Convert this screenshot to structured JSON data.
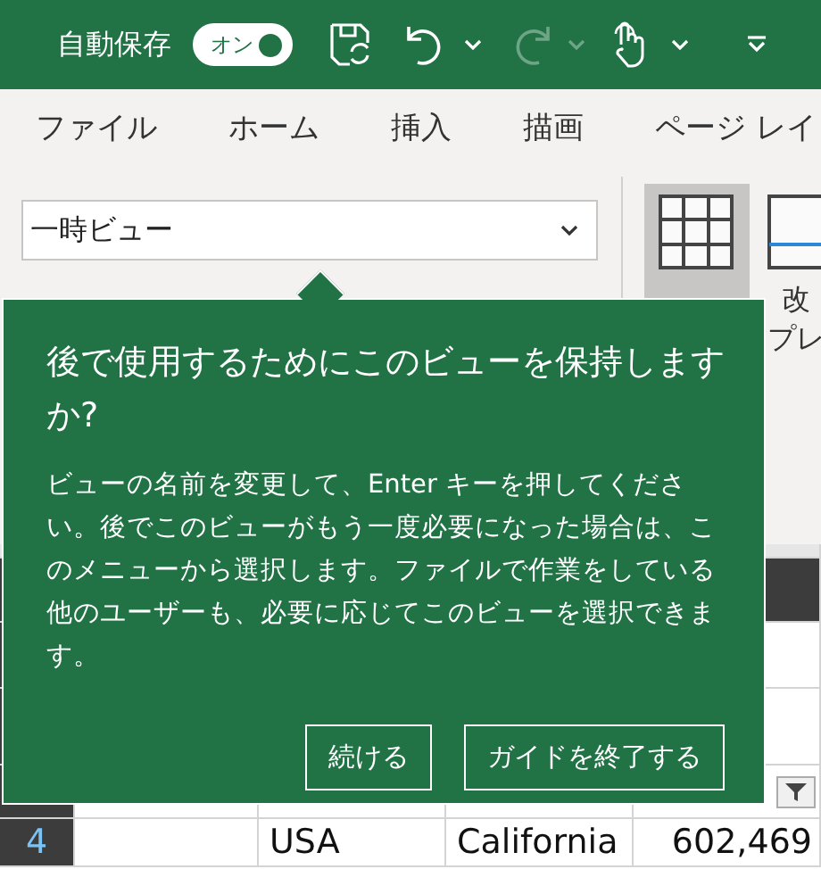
{
  "title_bar": {
    "autosave_label": "自動保存",
    "autosave_toggle": {
      "text": "オン",
      "on": true
    },
    "redo_enabled": false
  },
  "ribbon_tabs": [
    {
      "label": "ファイル",
      "selected": false
    },
    {
      "label": "ホーム",
      "selected": false
    },
    {
      "label": "挿入",
      "selected": false
    },
    {
      "label": "描画",
      "selected": false
    },
    {
      "label": "ページ レイ",
      "selected": false
    }
  ],
  "view_selector": {
    "value": "一時ビュー"
  },
  "view_buttons": [
    {
      "selected": true
    },
    {
      "lines": [
        "改",
        "プレ"
      ],
      "selected": false
    }
  ],
  "guide": {
    "title": "後で使用するためにこのビューを保持しますか?",
    "body": "ビューの名前を変更して、Enter キーを押してください。後でこのビューがもう一度必要になった場合は、このメニューから選択します。ファイルで作業をしている他のユーザーも、必要に応じてこのビューを選択できます。",
    "buttons": [
      "続ける",
      "ガイドを終了する"
    ]
  },
  "sheet": {
    "row_number": "4",
    "cells": [
      "USA",
      "California",
      "602,469"
    ]
  }
}
